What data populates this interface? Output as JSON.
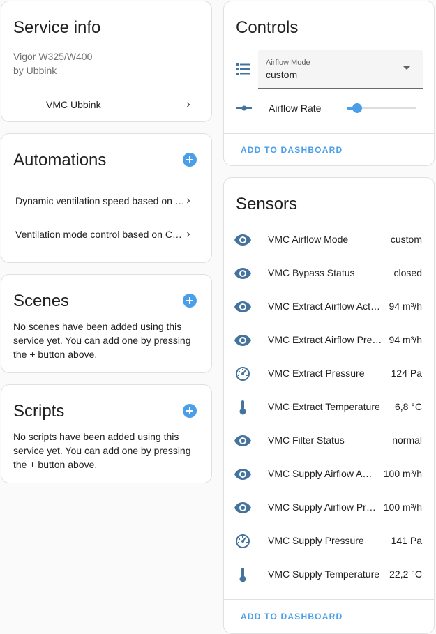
{
  "service_info": {
    "title": "Service info",
    "model": "Vigor W325/W400",
    "manufacturer": "by Ubbink",
    "device_link": "VMC Ubbink"
  },
  "automations": {
    "title": "Automations",
    "items": [
      "Dynamic ventilation speed based on …",
      "Ventilation mode control based on C…"
    ]
  },
  "scenes": {
    "title": "Scenes",
    "empty_text": "No scenes have been added using this service yet. You can add one by pressing the + button above."
  },
  "scripts": {
    "title": "Scripts",
    "empty_text": "No scripts have been added using this service yet. You can add one by pressing the + button above."
  },
  "controls": {
    "title": "Controls",
    "airflow_mode_label": "Airflow Mode",
    "airflow_mode_value": "custom",
    "airflow_rate_label": "Airflow Rate",
    "airflow_rate_fraction": 0.15,
    "add_to_dashboard": "ADD TO DASHBOARD"
  },
  "sensors": {
    "title": "Sensors",
    "items": [
      {
        "name": "VMC Airflow Mode",
        "value": "custom",
        "icon": "eye-icon"
      },
      {
        "name": "VMC Bypass Status",
        "value": "closed",
        "icon": "eye-icon"
      },
      {
        "name": "VMC Extract Airflow Act…",
        "value": "94 m³/h",
        "icon": "eye-icon"
      },
      {
        "name": "VMC Extract Airflow Pre…",
        "value": "94 m³/h",
        "icon": "eye-icon"
      },
      {
        "name": "VMC Extract Pressure",
        "value": "124 Pa",
        "icon": "gauge-icon"
      },
      {
        "name": "VMC Extract Temperature",
        "value": "6,8 °C",
        "icon": "thermometer-icon"
      },
      {
        "name": "VMC Filter Status",
        "value": "normal",
        "icon": "eye-icon"
      },
      {
        "name": "VMC Supply Airflow A…",
        "value": "100 m³/h",
        "icon": "eye-icon"
      },
      {
        "name": "VMC Supply Airflow Pr…",
        "value": "100 m³/h",
        "icon": "eye-icon"
      },
      {
        "name": "VMC Supply Pressure",
        "value": "141 Pa",
        "icon": "gauge-icon"
      },
      {
        "name": "VMC Supply Temperature",
        "value": "22,2 °C",
        "icon": "thermometer-icon"
      }
    ],
    "add_to_dashboard": "ADD TO DASHBOARD"
  },
  "colors": {
    "accent": "#4a9fe8",
    "icon": "#44739e"
  }
}
